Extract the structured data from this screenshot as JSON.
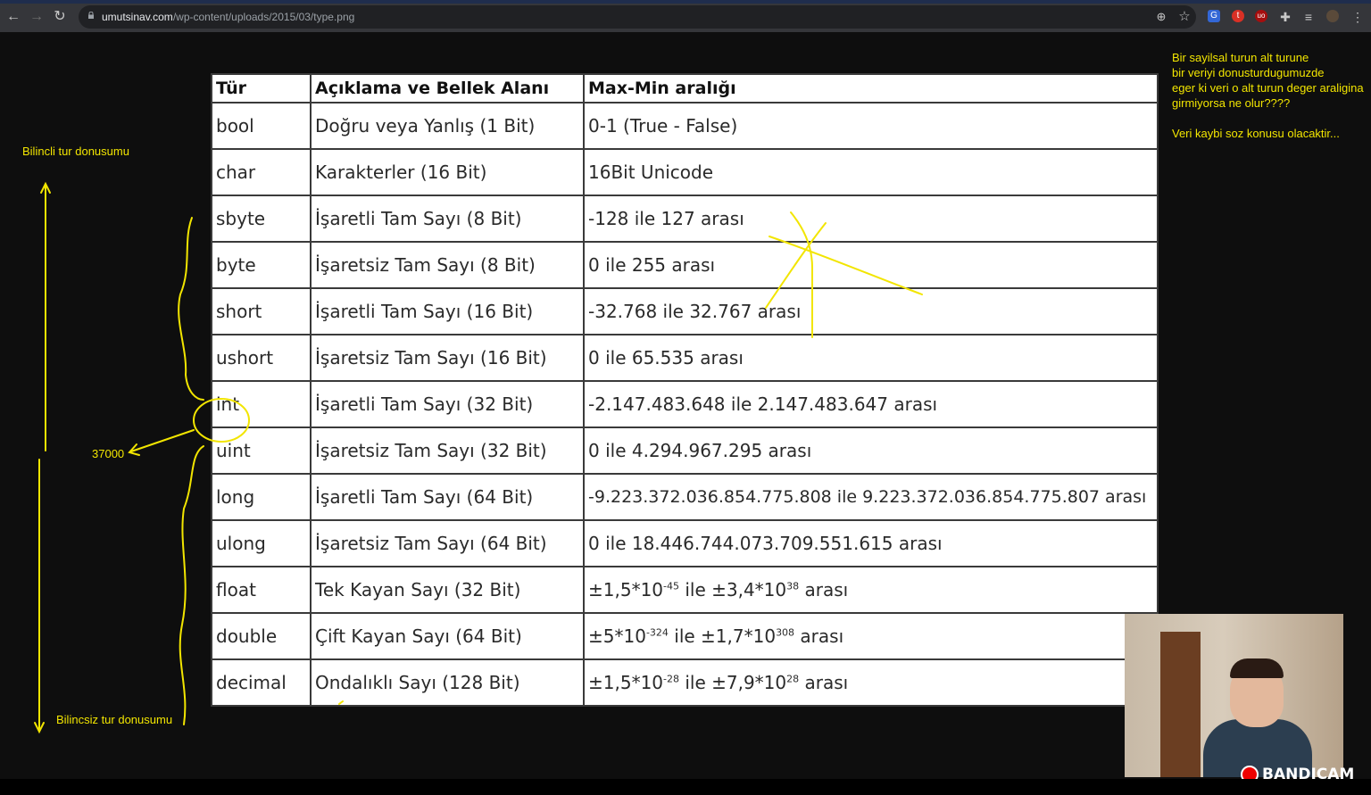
{
  "browser": {
    "url_host": "umutsinav.com",
    "url_path": "/wp-content/uploads/2015/03/type.png"
  },
  "table": {
    "headers": [
      "Tür",
      "Açıklama ve Bellek Alanı",
      "Max-Min aralığı"
    ],
    "rows": [
      {
        "type": "bool",
        "desc": "Doğru veya Yanlış (1 Bit)",
        "range": "0-1 (True - False)"
      },
      {
        "type": "char",
        "desc": "Karakterler (16 Bit)",
        "range": "16Bit Unicode"
      },
      {
        "type": "sbyte",
        "desc": "İşaretli Tam Sayı (8 Bit)",
        "range": "-128 ile 127 arası"
      },
      {
        "type": "byte",
        "desc": "İşaretsiz Tam Sayı (8 Bit)",
        "range": "0 ile 255 arası"
      },
      {
        "type": "short",
        "desc": "İşaretli Tam Sayı (16 Bit)",
        "range": "-32.768 ile 32.767 arası"
      },
      {
        "type": "ushort",
        "desc": "İşaretsiz Tam Sayı (16 Bit)",
        "range": "0 ile 65.535 arası"
      },
      {
        "type": "int",
        "desc": "İşaretli Tam Sayı (32 Bit)",
        "range": "-2.147.483.648 ile 2.147.483.647 arası"
      },
      {
        "type": "uint",
        "desc": "İşaretsiz Tam Sayı (32 Bit)",
        "range": "0 ile 4.294.967.295 arası"
      },
      {
        "type": "long",
        "desc": "İşaretli Tam Sayı (64 Bit)",
        "range": "-9.223.372.036.854.775.808 ile 9.223.372.036.854.775.807 arası"
      },
      {
        "type": "ulong",
        "desc": "İşaretsiz Tam Sayı (64 Bit)",
        "range": "0 ile 18.446.744.073.709.551.615 arası"
      },
      {
        "type": "float",
        "desc": "Tek Kayan Sayı (32 Bit)",
        "range_parts": [
          "±1,5*10",
          "-45",
          " ile ±3,4*10",
          "38",
          " arası"
        ]
      },
      {
        "type": "double",
        "desc": "Çift Kayan Sayı (64 Bit)",
        "range_parts": [
          "±5*10",
          "-324",
          " ile ±1,7*10",
          "308",
          " arası"
        ]
      },
      {
        "type": "decimal",
        "desc": "Ondalıklı Sayı (128 Bit)",
        "range_parts": [
          "±1,5*10",
          "-28",
          " ile ±7,9*10",
          "28",
          " arası"
        ]
      }
    ]
  },
  "annotations": {
    "explicit_label": "Bilincli tur donusumu",
    "implicit_label": "Bilincsiz tur donusumu",
    "value_label": "37000",
    "note_lines": [
      "Bir sayilsal turun alt turune",
      "bir veriyi donusturdugumuzde",
      "eger ki veri o alt turun deger araligina",
      "girmiyorsa ne olur????",
      "",
      "Veri kaybi soz konusu olacaktir..."
    ],
    "ink_color": "#f2e500"
  },
  "overlay": {
    "watermark": "BANDICAM"
  }
}
